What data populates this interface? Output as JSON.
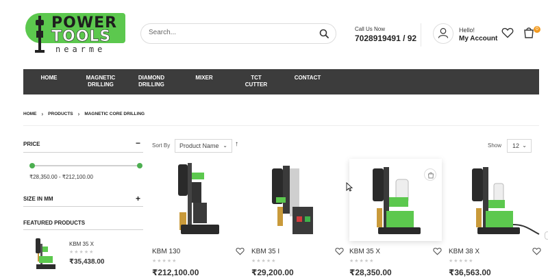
{
  "header": {
    "logo_power": "POWER",
    "logo_tools": "TOOLS",
    "logo_nearme": "nearme",
    "search_placeholder": "Search...",
    "call_label": "Call Us Now",
    "call_number": "7028919491 / 92",
    "hello": "Hello!",
    "account_label": "My Account",
    "cart_count": "0",
    "icons": [
      "search-icon",
      "user-icon",
      "heart-icon",
      "cart-icon"
    ],
    "brand_color": "#5cc84e",
    "badge_color": "#f29a1f"
  },
  "nav": {
    "items": [
      {
        "line1": "Home",
        "line2": ""
      },
      {
        "line1": "MAGNETIC",
        "line2": "DRILLING"
      },
      {
        "line1": "DIAMOND",
        "line2": "DRILLING"
      },
      {
        "line1": "MIXER",
        "line2": ""
      },
      {
        "line1": "TCT CUTTER",
        "line2": ""
      },
      {
        "line1": "CONTACT",
        "line2": ""
      }
    ],
    "background": "#3c3c3c"
  },
  "breadcrumb": [
    "HOME",
    "PRODUCTS",
    "MAGNETIC CORE DRILLING"
  ],
  "sidebar": {
    "price_title": "PRICE",
    "price_toggle": "−",
    "price_min": 28350,
    "price_max": 212100,
    "price_range_text": "₹28,350.00 - ₹212,100.00",
    "size_title": "SIZE IN MM",
    "size_toggle": "+",
    "featured_title": "FEATURED PRODUCTS",
    "featured": {
      "name": "KBM 35 X",
      "stars": "★★★★★",
      "price": "₹35,438.00"
    }
  },
  "toolbar": {
    "sort_label": "Sort By",
    "sort_value": "Product Name",
    "sort_direction": "↑",
    "show_label": "Show",
    "show_value": "12"
  },
  "products": [
    {
      "name": "KBM 130",
      "stars": "★★★★★",
      "price": "₹212,100.00"
    },
    {
      "name": "KBM 35 I",
      "stars": "★★★★★",
      "price": "₹29,200.00"
    },
    {
      "name": "KBM 35 X",
      "stars": "★★★★★",
      "price": "₹28,350.00"
    },
    {
      "name": "KBM 38 X",
      "stars": "★★★★★",
      "price": "₹36,563.00"
    }
  ]
}
